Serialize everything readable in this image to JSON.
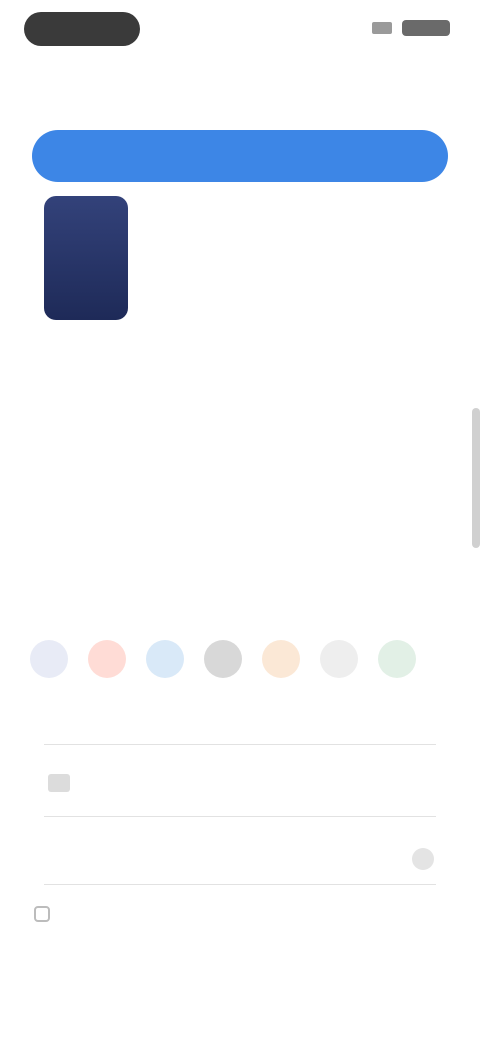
{
  "nav": {
    "title": ""
  },
  "cta": {
    "label": ""
  },
  "product": {
    "name": "",
    "subtitle": ""
  },
  "summary": {
    "rows": [
      {
        "label": "",
        "value": ""
      },
      {
        "label": "",
        "value": ""
      },
      {
        "label": "",
        "value": ""
      }
    ],
    "details_link": "",
    "notice": ""
  },
  "payment": {
    "title": "",
    "methods": [
      "method-1-icon",
      "method-2-icon",
      "method-3-icon",
      "method-4-icon",
      "method-5-icon",
      "method-6-icon",
      "method-7-icon"
    ],
    "field_label": "",
    "field_value": "",
    "card_title": "",
    "card_subtitle": "",
    "expiry_label": "",
    "expiry_value": "",
    "cvc_label": "",
    "cvc_value": "",
    "checkbox_label": ""
  },
  "subsection": {
    "title": ""
  },
  "colors": {
    "accent": "#3d86e6",
    "success": "#2e8b4f"
  }
}
